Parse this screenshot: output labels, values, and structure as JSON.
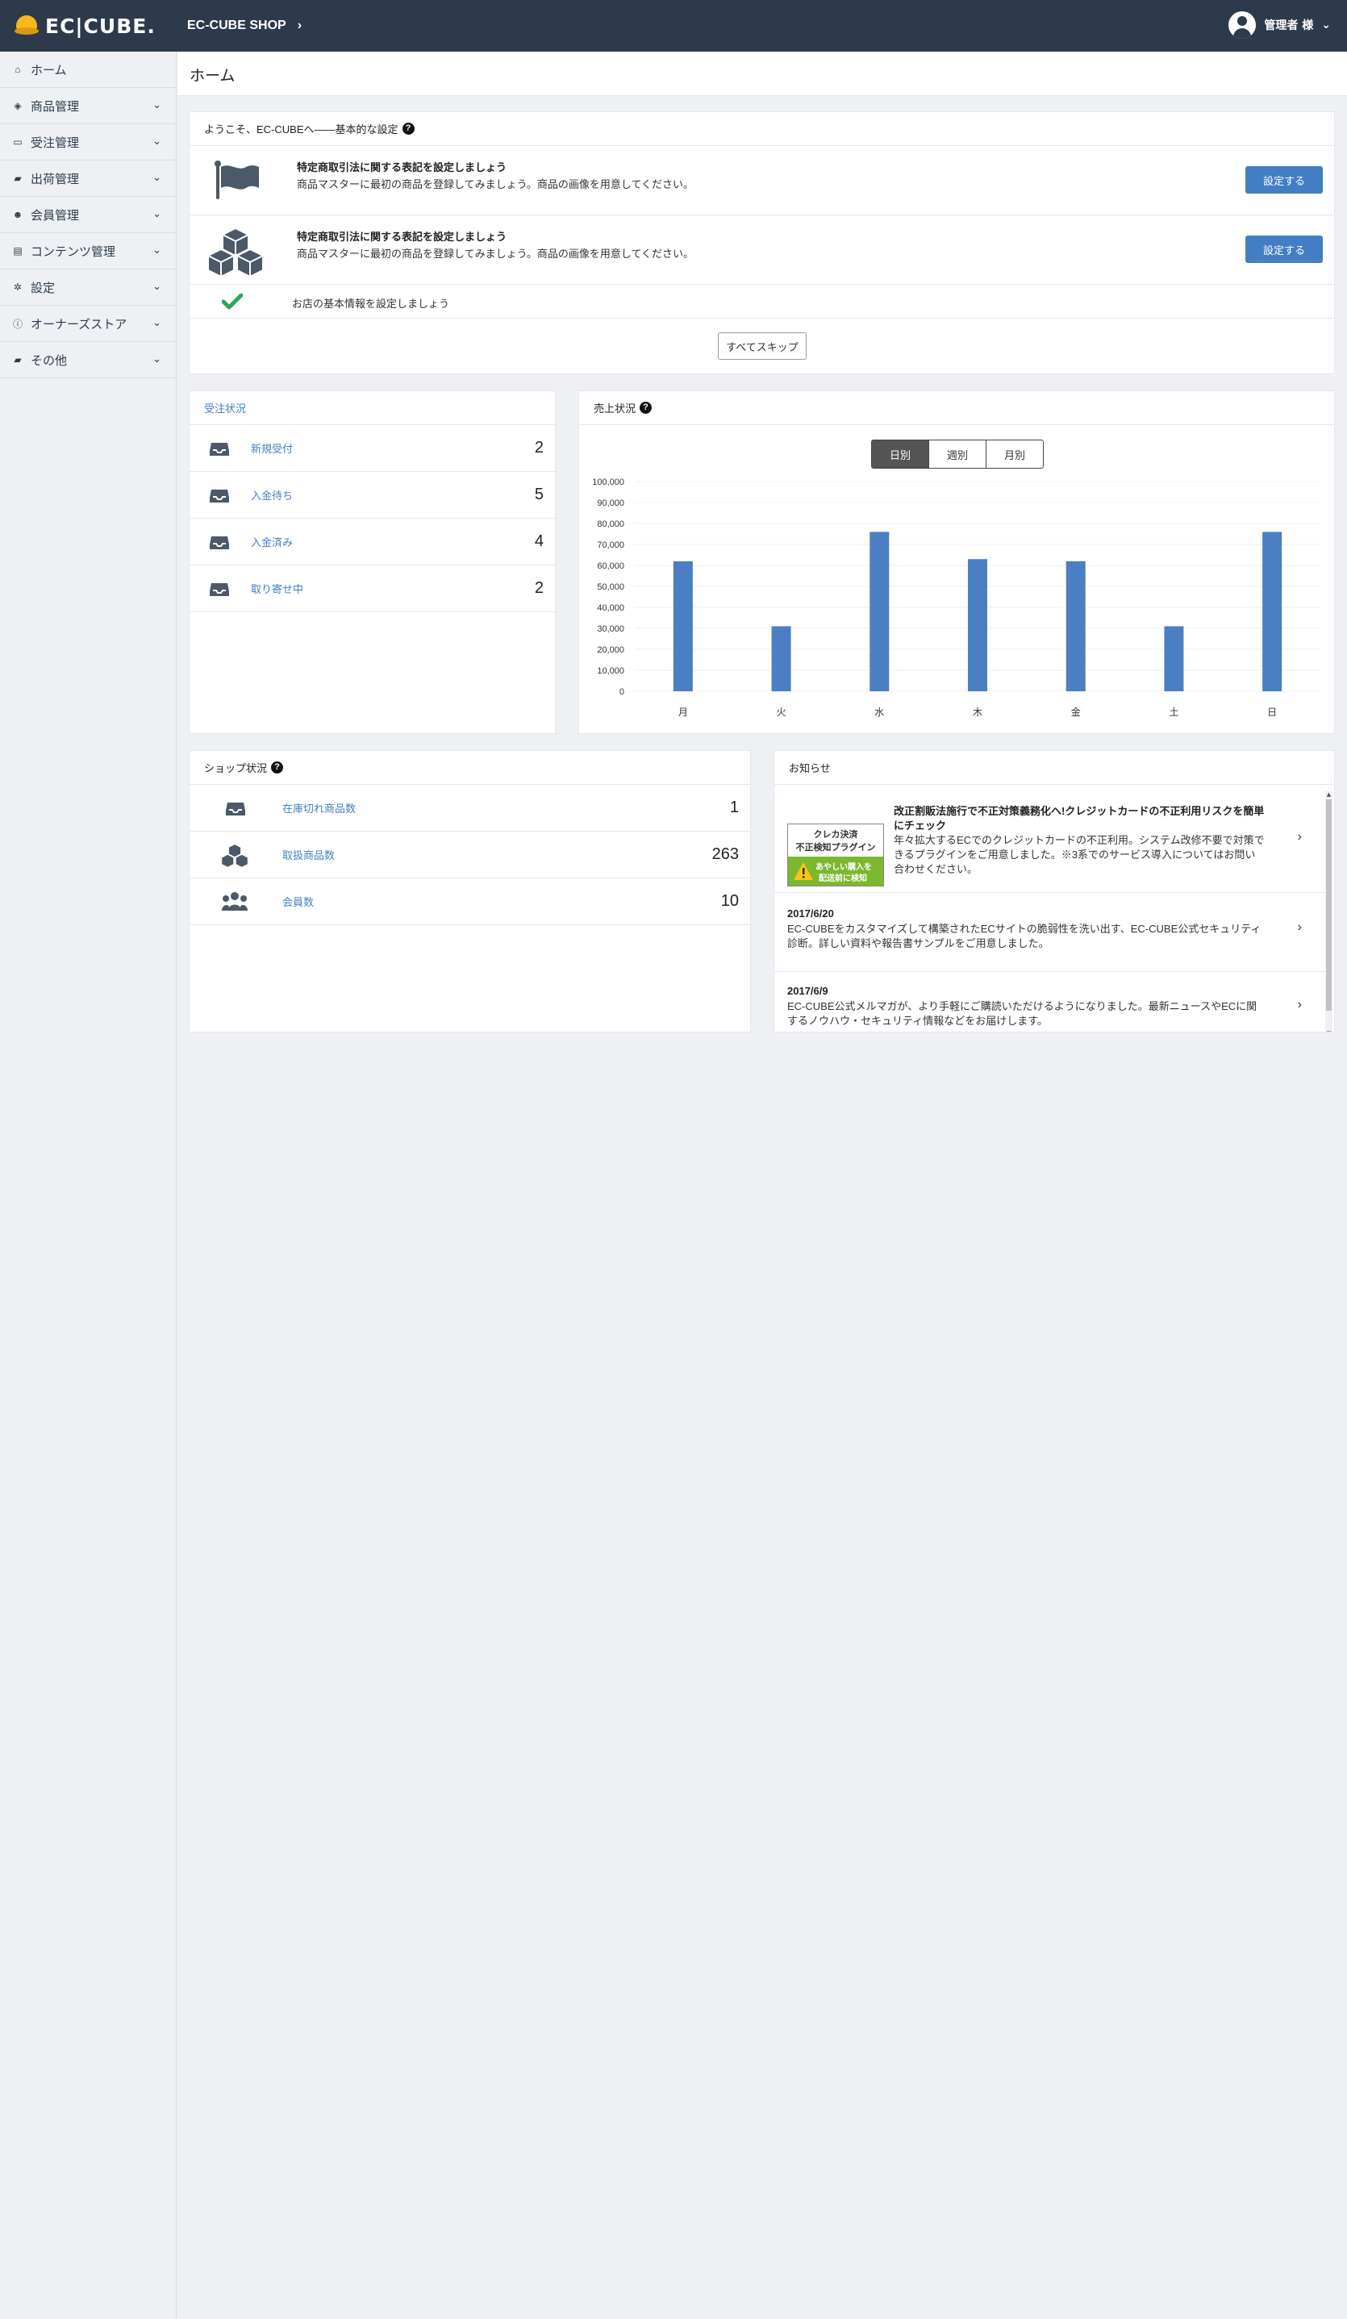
{
  "header": {
    "logo_text": "EC|CUBE.",
    "shop_name": "EC-CUBE SHOP",
    "user_name": "管理者 様"
  },
  "sidebar": {
    "items": [
      {
        "label": "ホーム",
        "icon": "home-icon"
      },
      {
        "label": "商品管理",
        "icon": "cube-icon"
      },
      {
        "label": "受注管理",
        "icon": "inbox-icon"
      },
      {
        "label": "出荷管理",
        "icon": "truck-icon"
      },
      {
        "label": "会員管理",
        "icon": "users-icon"
      },
      {
        "label": "コンテンツ管理",
        "icon": "file-icon"
      },
      {
        "label": "設定",
        "icon": "gear-icon"
      },
      {
        "label": "オーナーズストア",
        "icon": "info-icon"
      },
      {
        "label": "その他",
        "icon": "truck-icon"
      }
    ]
  },
  "page": {
    "title": "ホーム"
  },
  "welcome": {
    "title": "ようこそ、EC-CUBEへ――基本的な設定",
    "rows": [
      {
        "title": "特定商取引法に関する表記を設定しましょう",
        "desc": "商品マスターに最初の商品を登録してみましょう。商品の画像を用意してください。",
        "button": "設定する"
      },
      {
        "title": "特定商取引法に関する表記を設定しましょう",
        "desc": "商品マスターに最初の商品を登録してみましょう。商品の画像を用意してください。",
        "button": "設定する"
      }
    ],
    "done_item": "お店の基本情報を設定しましょう",
    "skip_all": "すべてスキップ"
  },
  "orders": {
    "title": "受注状況",
    "rows": [
      {
        "label": "新規受付",
        "value": "2"
      },
      {
        "label": "入金待ち",
        "value": "5"
      },
      {
        "label": "入金済み",
        "value": "4"
      },
      {
        "label": "取り寄せ中",
        "value": "2"
      }
    ]
  },
  "sales": {
    "title": "売上状況",
    "tabs": [
      "日別",
      "週別",
      "月別"
    ],
    "active_tab": 0
  },
  "chart_data": {
    "type": "bar",
    "categories": [
      "月",
      "火",
      "水",
      "木",
      "金",
      "土",
      "日"
    ],
    "values": [
      62000,
      31000,
      76000,
      63000,
      62000,
      31000,
      76000
    ],
    "ylim": [
      0,
      100000
    ],
    "yticks": [
      "100,000",
      "90,000",
      "80,000",
      "70,000",
      "60,000",
      "50,000",
      "40,000",
      "30,000",
      "20,000",
      "10,000",
      "0"
    ],
    "grid": true,
    "color": "#4a7fc4"
  },
  "shop": {
    "title": "ショップ状況",
    "rows": [
      {
        "label": "在庫切れ商品数",
        "value": "1"
      },
      {
        "label": "取扱商品数",
        "value": "263"
      },
      {
        "label": "会員数",
        "value": "10"
      }
    ]
  },
  "news": {
    "title": "お知らせ",
    "banner": {
      "line1": "クレカ決済",
      "line2": "不正検知プラグイン",
      "line3": "あやしい購入を",
      "line4": "配送前に検知"
    },
    "items": [
      {
        "date": "",
        "title": "改正割販法施行で不正対策義務化へ!クレジットカードの不正利用リスクを簡単にチェック",
        "body": "年々拡大するECでのクレジットカードの不正利用。システム改修不要で対策できるプラグインをご用意しました。※3系でのサービス導入についてはお問い合わせください。"
      },
      {
        "date": "2017/6/20",
        "title": "",
        "body": "EC-CUBEをカスタマイズして構築されたECサイトの脆弱性を洗い出す、EC-CUBE公式セキュリティ診断。詳しい資料や報告書サンプルをご用意しました。"
      },
      {
        "date": "2017/6/9",
        "title": "",
        "body": "EC-CUBE公式メルマガが、より手軽にご購読いただけるようになりました。最新ニュースやECに関するノウハウ・セキュリティ情報などをお届けします。"
      }
    ]
  }
}
